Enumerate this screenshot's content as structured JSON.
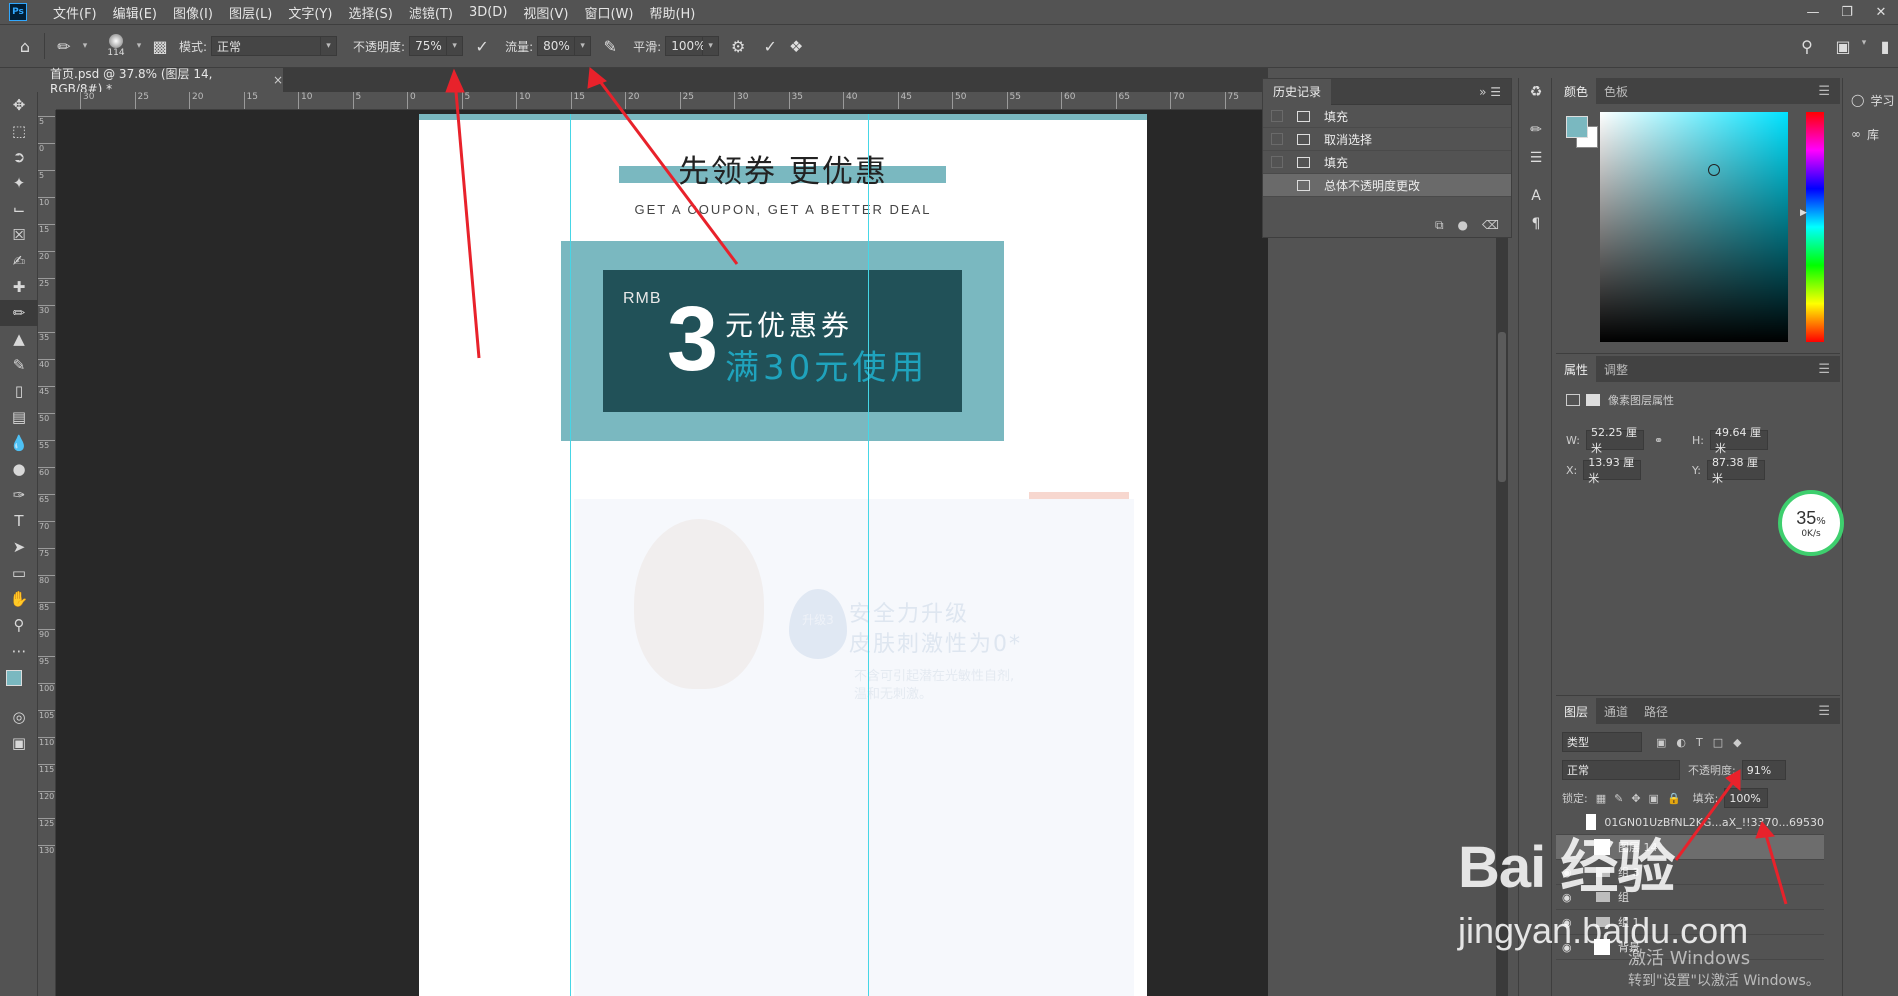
{
  "app": {
    "logo": "Ps"
  },
  "menubar": {
    "items": [
      "文件(F)",
      "编辑(E)",
      "图像(I)",
      "图层(L)",
      "文字(Y)",
      "选择(S)",
      "滤镜(T)",
      "3D(D)",
      "视图(V)",
      "窗口(W)",
      "帮助(H)"
    ]
  },
  "options": {
    "brush_size": "114",
    "mode_label": "模式:",
    "mode_value": "正常",
    "opacity_label": "不透明度:",
    "opacity_value": "75%",
    "flow_label": "流量:",
    "flow_value": "80%",
    "smooth_label": "平滑:",
    "smooth_value": "100%"
  },
  "document": {
    "tab_title": "首页.psd @ 37.8% (图层 14, RGB/8#) *",
    "close": "×",
    "headline": "先领券 更优惠",
    "subline": "GET A COUPON, GET A BETTER DEAL",
    "coupon": {
      "currency": "RMB",
      "amount": "3",
      "label": "元优惠券",
      "condition": "满30元使用"
    },
    "faded": {
      "badge": "升级3",
      "line1": "安全力升级",
      "line2": "皮肤刺激性为0*",
      "line3": "不含可引起潜在光敏性自剂,",
      "line4": "温和无刺激。"
    }
  },
  "rulers": {
    "top": [
      "30",
      "25",
      "20",
      "15",
      "10",
      "5",
      "0",
      "5",
      "10",
      "15",
      "20",
      "25",
      "30",
      "35",
      "40",
      "45",
      "50",
      "55",
      "60",
      "65",
      "70",
      "75"
    ],
    "left": [
      "5",
      "0",
      "5",
      "10",
      "15",
      "20",
      "25",
      "30",
      "35",
      "40",
      "45",
      "50",
      "55",
      "60",
      "65",
      "70",
      "75",
      "80",
      "85",
      "90",
      "95",
      "100",
      "105",
      "110",
      "115",
      "120",
      "125",
      "130"
    ]
  },
  "history": {
    "title": "历史记录",
    "items": [
      "填充",
      "取消选择",
      "填充",
      "总体不透明度更改"
    ],
    "selected_index": 3
  },
  "color_panel": {
    "tabs": [
      "颜色",
      "色板"
    ],
    "foreground": "#7ab8c0",
    "background": "#ffffff"
  },
  "properties": {
    "tabs": [
      "属性",
      "调整"
    ],
    "title": "像素图层属性",
    "w_label": "W:",
    "w_value": "52.25 厘米",
    "h_label": "H:",
    "h_value": "49.64 厘米",
    "x_label": "X:",
    "x_value": "13.93 厘米",
    "y_label": "Y:",
    "y_value": "87.38 厘米"
  },
  "layers": {
    "tabs": [
      "图层",
      "通道",
      "路径"
    ],
    "filter_label": "类型",
    "blend_mode": "正常",
    "opacity_label": "不透明度:",
    "opacity_value": "91%",
    "lock_label": "锁定:",
    "fill_label": "填充:",
    "fill_value": "100%",
    "rows": [
      {
        "name": "01GN01UzBfNL2KG...aX_!!3370...69530"
      },
      {
        "name": "图层 14"
      },
      {
        "name": "组 3"
      },
      {
        "name": "组"
      },
      {
        "name": "组 1"
      },
      {
        "name": "背景"
      }
    ],
    "selected_index": 1
  },
  "right_col": {
    "learn": "学习",
    "libraries": "库"
  },
  "speed_widget": {
    "percent": "35",
    "percent_sign": "%",
    "rate": "0K/s"
  },
  "watermark": {
    "logo": "Bai 经验",
    "url": "jingyan.baidu.com"
  },
  "windows_notice": {
    "line1": "激活 Windows",
    "line2": "转到\"设置\"以激活 Windows。"
  },
  "colors": {
    "accent_teal": "#7ab8c0",
    "coupon_dark": "#215158",
    "coupon_cyan": "#1fa3bd",
    "guide": "#46d6e6",
    "annotation_arrow": "#e8222b"
  }
}
